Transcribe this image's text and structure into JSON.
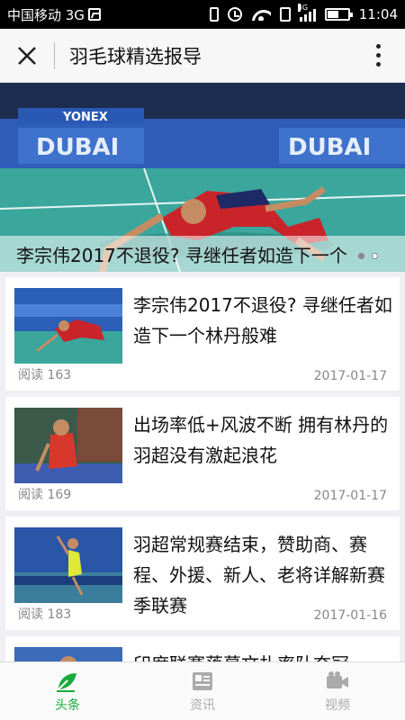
{
  "status_bar": {
    "carrier": "中国移动 3G",
    "time": "11:04",
    "network": "3G"
  },
  "nav": {
    "title": "羽毛球精选报导"
  },
  "banner": {
    "caption": "李宗伟2017不退役? 寻继任者如造下一个",
    "slide_count": 2,
    "active_slide": 1
  },
  "articles": [
    {
      "title": "李宗伟2017不退役? 寻继任者如造下一个林丹般难",
      "reads": "阅读 163",
      "date": "2017-01-17"
    },
    {
      "title": "出场率低+风波不断 拥有林丹的羽超没有激起浪花",
      "reads": "阅读 169",
      "date": "2017-01-17"
    },
    {
      "title": "羽超常规赛结束，赞助商、赛程、外援、新人、老将详解新赛季联赛",
      "reads": "阅读 183",
      "date": "2017-01-16"
    },
    {
      "title": "印度联赛落幕文扎率队夺冠",
      "reads": "",
      "date": ""
    }
  ],
  "tabs": [
    {
      "label": "头条",
      "icon": "headline-icon",
      "active": true
    },
    {
      "label": "资讯",
      "icon": "news-icon",
      "active": false
    },
    {
      "label": "视频",
      "icon": "video-icon",
      "active": false
    }
  ],
  "colors": {
    "accent": "#1aaa3a",
    "inactive": "#aaaaaa"
  },
  "banner_text": {
    "sponsor": "YONEX",
    "board": "DUBAI"
  }
}
